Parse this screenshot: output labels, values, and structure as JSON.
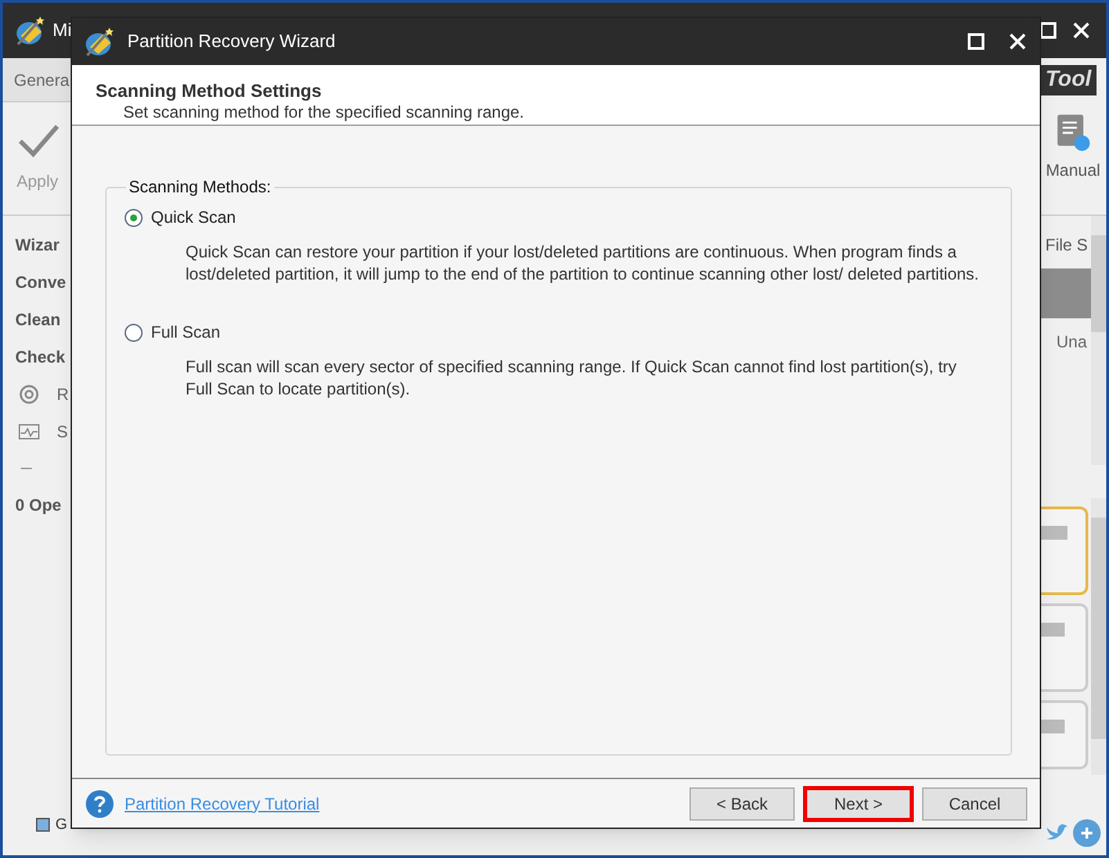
{
  "background_app": {
    "title": "Mi",
    "tab": "Genera",
    "apply": "Apply",
    "sections": [
      "Wizar",
      "Conve",
      "Clean",
      "Check"
    ],
    "items": [
      {
        "kind": "refresh",
        "label": "R"
      },
      {
        "kind": "monitor",
        "label": "S"
      }
    ],
    "operations": "0 Ope",
    "legend": "G",
    "logo": "Tool",
    "manual": "Manual",
    "column": "File S",
    "cell": "Una"
  },
  "dialog": {
    "title": "Partition Recovery Wizard",
    "heading": "Scanning Method Settings",
    "subheading": "Set scanning method for the specified scanning range.",
    "group_label": "Scanning Methods:",
    "options": [
      {
        "label": "Quick Scan",
        "selected": true,
        "description": "Quick Scan can restore your partition if your lost/deleted partitions are continuous. When program finds a lost/deleted partition, it will jump to the end of the partition to continue scanning other lost/ deleted partitions."
      },
      {
        "label": "Full Scan",
        "selected": false,
        "description": "Full scan will scan every sector of specified scanning range. If Quick Scan cannot find lost partition(s), try Full Scan to locate partition(s)."
      }
    ],
    "tutorial_link": "Partition Recovery Tutorial",
    "buttons": [
      {
        "label": "< Back",
        "highlighted": false
      },
      {
        "label": "Next >",
        "highlighted": true
      },
      {
        "label": "Cancel",
        "highlighted": false
      }
    ]
  }
}
